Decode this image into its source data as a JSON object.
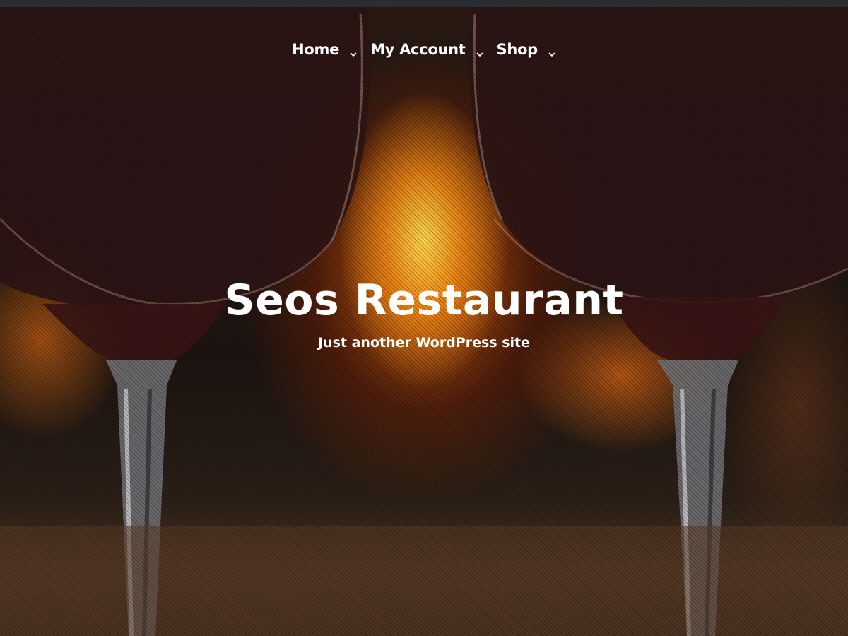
{
  "nav": {
    "items": [
      {
        "label": "Home",
        "icon": "chevron-down-icon"
      },
      {
        "label": "My Account",
        "icon": "chevron-down-icon"
      },
      {
        "label": "Shop",
        "icon": "chevron-down-icon"
      }
    ]
  },
  "site": {
    "title": "Seos Restaurant",
    "tagline": "Just another WordPress site"
  },
  "colors": {
    "text": "#ffffff",
    "topbar": "#2a2d31",
    "fire": "#f28a1a",
    "wine": "#3a1616"
  }
}
